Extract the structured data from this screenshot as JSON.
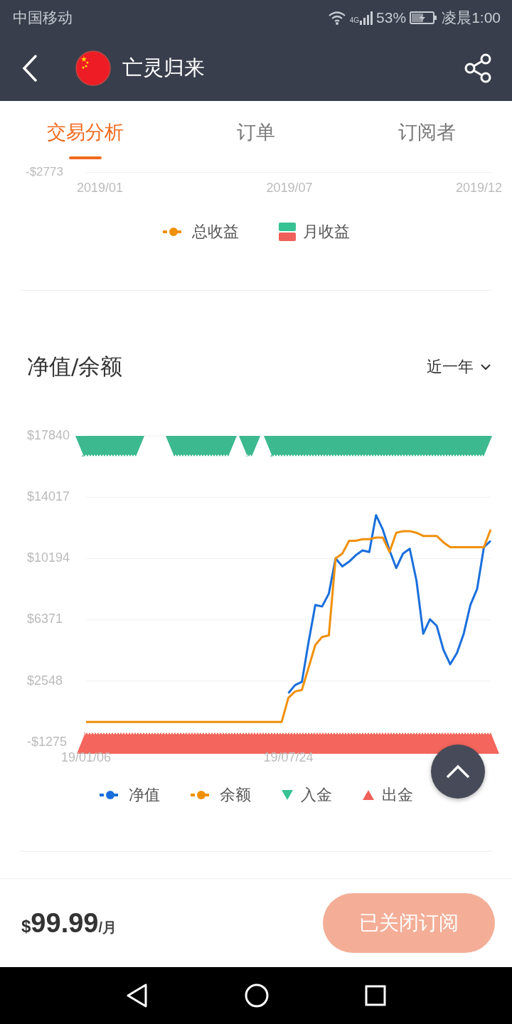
{
  "status_bar": {
    "carrier": "中国移动",
    "network_type": "4G",
    "battery": "53%",
    "time": "凌晨1:00"
  },
  "header": {
    "title": "亡灵归来"
  },
  "tabs": [
    {
      "label": "交易分析",
      "selected": true
    },
    {
      "label": "订单",
      "selected": false
    },
    {
      "label": "订阅者",
      "selected": false
    }
  ],
  "profit_chart": {
    "ytick": "-$2773",
    "xticks": [
      "2019/01",
      "2019/07",
      "2019/12"
    ],
    "legend": [
      {
        "label": "总收益",
        "kind": "line",
        "color": "#f0900a"
      },
      {
        "label": "月收益",
        "kind": "bars",
        "color": "#36c293"
      }
    ]
  },
  "equity_section": {
    "title": "净值/余额",
    "period": "近一年",
    "chart_data": {
      "type": "line",
      "categories": [
        "19/01/06",
        null,
        null,
        null,
        null,
        null,
        null,
        null,
        null,
        null,
        null,
        null,
        null,
        null,
        null,
        null,
        null,
        null,
        null,
        null,
        null,
        null,
        null,
        null,
        null,
        null,
        null,
        null,
        null,
        null,
        "19/07/24",
        null,
        null,
        null,
        null,
        null,
        null,
        null,
        null,
        null,
        null,
        null,
        null,
        null,
        null,
        null,
        null,
        null,
        null,
        null,
        null,
        null,
        null,
        null,
        null,
        null,
        null,
        null,
        null,
        null,
        null
      ],
      "ylim": [
        -1275,
        17840
      ],
      "grid": true,
      "yticks": [
        {
          "value": 17840,
          "label": "$17840"
        },
        {
          "value": 14017,
          "label": "$14017"
        },
        {
          "value": 10194,
          "label": "$10194"
        },
        {
          "value": 6371,
          "label": "$6371"
        },
        {
          "value": 2548,
          "label": "$2548"
        },
        {
          "value": -1275,
          "label": "-$1275"
        }
      ],
      "series": [
        {
          "name": "净值",
          "color": "#1a6fdc",
          "values": [
            null,
            null,
            null,
            null,
            null,
            null,
            null,
            null,
            null,
            null,
            null,
            null,
            null,
            null,
            null,
            null,
            null,
            null,
            null,
            null,
            null,
            null,
            null,
            null,
            null,
            null,
            null,
            null,
            null,
            null,
            1800,
            2300,
            2500,
            5000,
            7300,
            7200,
            8000,
            10200,
            9700,
            10000,
            10400,
            10700,
            10600,
            12900,
            12000,
            10700,
            9600,
            10500,
            10800,
            8800,
            5500,
            6400,
            6000,
            4500,
            3600,
            4300,
            5500,
            7300,
            8300,
            10900,
            11300
          ]
        },
        {
          "name": "余额",
          "color": "#f0900a",
          "values": [
            0,
            0,
            0,
            0,
            0,
            0,
            0,
            0,
            0,
            0,
            0,
            0,
            0,
            0,
            0,
            0,
            0,
            0,
            0,
            0,
            0,
            0,
            0,
            0,
            0,
            0,
            0,
            0,
            0,
            0,
            1500,
            1900,
            2000,
            3400,
            4800,
            5300,
            5400,
            10200,
            10500,
            11300,
            11300,
            11400,
            11400,
            11500,
            11500,
            10600,
            11800,
            11900,
            11900,
            11800,
            11600,
            11600,
            11600,
            11200,
            10900,
            10900,
            10900,
            10900,
            10900,
            10900,
            12000
          ]
        }
      ]
    },
    "legend": [
      {
        "label": "入金",
        "kind": "down",
        "color": "#36c293"
      },
      {
        "label": "出金",
        "kind": "up",
        "color": "#f0605a"
      }
    ]
  },
  "footer": {
    "currency": "$",
    "amount": "99.99",
    "unit": "/月",
    "button": {
      "label": "已关闭订阅",
      "disabled": true
    }
  }
}
